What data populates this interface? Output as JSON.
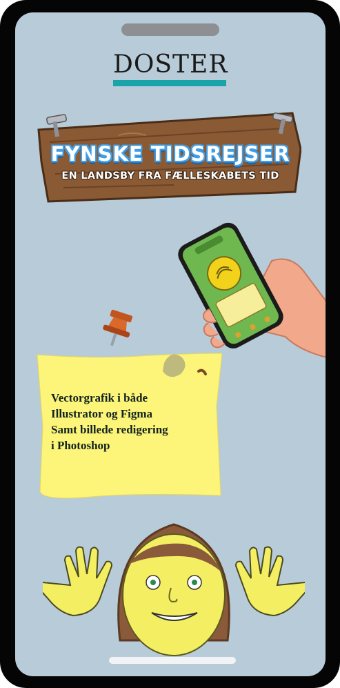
{
  "brand": {
    "name": "DOSTER",
    "accent_color": "#1aa3a8"
  },
  "hero": {
    "title": "FYNSKE TIDSREJSER",
    "subtitle": "EN LANDSBY FRA FÆLLESKABETS TID"
  },
  "note": {
    "lines": [
      "Vectorgrafik i både",
      "Illustrator og Figma",
      "Samt billede redigering",
      "i Photoshop"
    ]
  },
  "colors": {
    "background": "#b8cbd9",
    "wood": "#8a5a34",
    "note": "#fdf47a",
    "phone_screen": "#6fb84f"
  }
}
